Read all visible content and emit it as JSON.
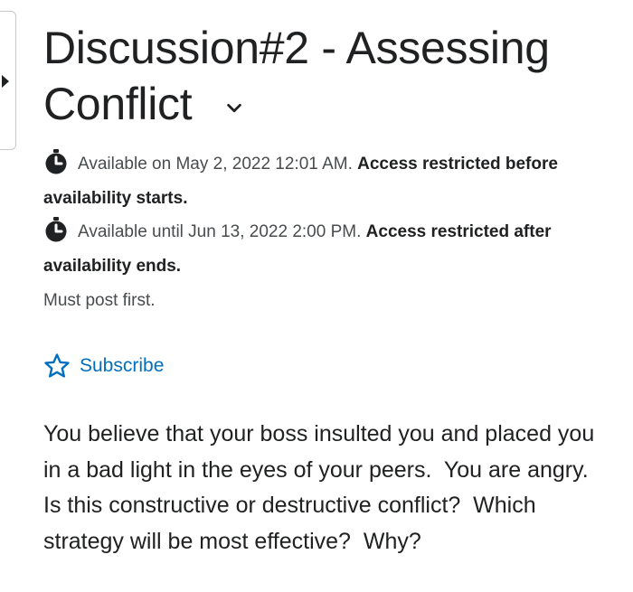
{
  "panel": {
    "toggle_icon": "caret-right-icon"
  },
  "topic": {
    "title_line1": "Discussion#2 - Assessing",
    "title_line2": "Conflict",
    "menu_icon": "chevron-down-icon"
  },
  "availability": [
    {
      "icon": "clock-icon",
      "text": "Available on May 2, 2022 12:01 AM.",
      "restriction": "Access restricted before availability starts."
    },
    {
      "icon": "clock-icon",
      "text": "Available until Jun 13, 2022 2:00 PM.",
      "restriction": "Access restricted after availability ends."
    }
  ],
  "must_post": "Must post first.",
  "subscribe": {
    "label": "Subscribe",
    "icon": "star-outline-icon",
    "color": "#006fbf"
  },
  "description": "You believe that your boss insulted you and placed you in a bad light in the eyes of your peers.  You are angry.  Is this constructive or destructive conflict?  Which strategy will be most effective?  Why?"
}
